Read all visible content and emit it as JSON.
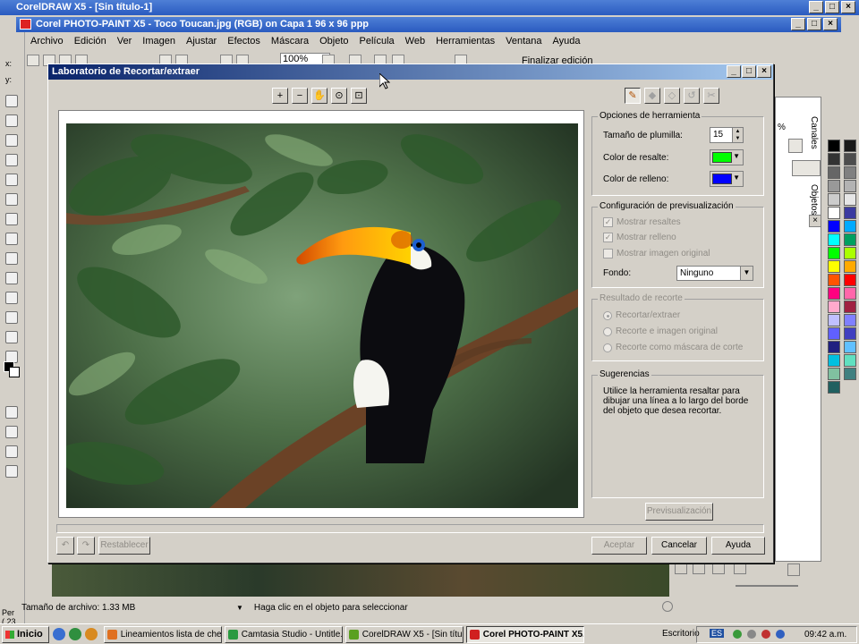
{
  "outer_window": {
    "title": "CorelDRAW X5 - [Sin título-1]"
  },
  "app_window": {
    "title": "Corel PHOTO-PAINT X5 - Toco Toucan.jpg (RGB) on Capa 1 96 x 96 ppp"
  },
  "menu": [
    "Archivo",
    "Edición",
    "Ver",
    "Imagen",
    "Ajustar",
    "Efectos",
    "Máscara",
    "Objeto",
    "Película",
    "Web",
    "Herramientas",
    "Ventana",
    "Ayuda"
  ],
  "toolbar": {
    "zoom": "100%",
    "finalize": "Finalizar edición"
  },
  "dialog": {
    "title": "Laboratorio de Recortar/extraer",
    "tool_options": {
      "heading": "Opciones de herramienta",
      "nib_size_label": "Tamaño de plumilla:",
      "nib_size_value": "15",
      "highlight_color_label": "Color de resalte:",
      "highlight_color": "#00ff00",
      "fill_color_label": "Color de relleno:",
      "fill_color": "#0000ff"
    },
    "preview_config": {
      "heading": "Configuración de previsualización",
      "show_highlight": "Mostrar resaltes",
      "show_fill": "Mostrar relleno",
      "show_original": "Mostrar imagen original",
      "background_label": "Fondo:",
      "background_value": "Ninguno"
    },
    "crop_result": {
      "heading": "Resultado de recorte",
      "option_1": "Recortar/extraer",
      "option_2": "Recorte e imagen original",
      "option_3": "Recorte como máscara de corte"
    },
    "hints": {
      "heading": "Sugerencias",
      "text": "Utilice la herramienta resaltar para dibujar una línea a lo largo del borde del objeto que desea recortar."
    },
    "buttons": {
      "preview": "Previsualización",
      "reset": "Restablecer",
      "accept": "Aceptar",
      "cancel": "Cancelar",
      "help": "Ayuda"
    }
  },
  "docker": {
    "tab_channels": "Canales",
    "tab_objects": "Objetos",
    "percent": "%"
  },
  "status": {
    "left_partial": "( 23",
    "left_partial_2": "Per",
    "file_size": "Tamaño de archivo: 1.33 MB",
    "hint": "Haga clic en el objeto para seleccionar",
    "coord_x": "x:",
    "coord_y": "y:"
  },
  "taskbar": {
    "start": "Inicio",
    "tasks": [
      "Lineamientos lista de che...",
      "Camtasia Studio - Untitle...",
      "CorelDRAW X5 - [Sin títul...",
      "Corel PHOTO-PAINT X5..."
    ],
    "desktop": "Escritorio",
    "lang": "ES",
    "time": "09:42 a.m."
  },
  "palette_colors": [
    "#000000",
    "#1a1a1a",
    "#333333",
    "#4d4d4d",
    "#666666",
    "#808080",
    "#999999",
    "#b3b3b3",
    "#cccccc",
    "#e6e6e6",
    "#ffffff",
    "#3a3aa0",
    "#0000ff",
    "#00aaff",
    "#00ffff",
    "#00a060",
    "#00ff00",
    "#aaff00",
    "#ffff00",
    "#ffaa00",
    "#ff5500",
    "#ff0000",
    "#ff0080",
    "#ff66aa",
    "#ffaacc",
    "#a02040",
    "#c0c0ff",
    "#8080ff",
    "#6060ff",
    "#4040c0",
    "#202080",
    "#60c0ff",
    "#00c0e0",
    "#60e0c0",
    "#80c0a0",
    "#408080",
    "#206060"
  ]
}
